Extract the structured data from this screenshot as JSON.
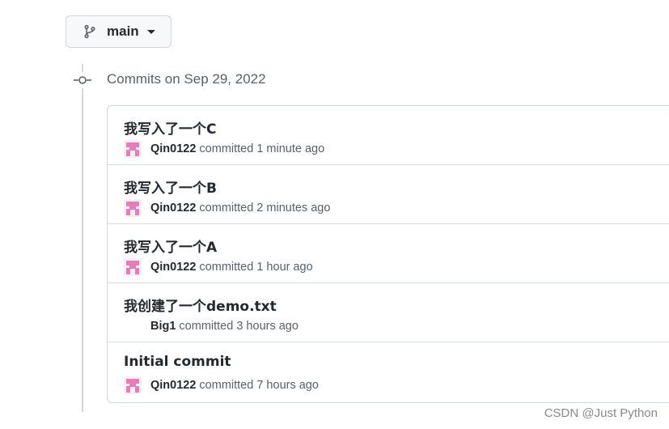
{
  "branch": {
    "name": "main",
    "icon": "git-branch-icon"
  },
  "timeline": {
    "heading": "Commits on Sep 29, 2022",
    "node_icon": "git-commit-icon"
  },
  "commits": [
    {
      "title": "我写入了一个C",
      "author": "Qin0122",
      "action": "committed",
      "time": "1 minute ago",
      "has_avatar": true
    },
    {
      "title": "我写入了一个B",
      "author": "Qin0122",
      "action": "committed",
      "time": "2 minutes ago",
      "has_avatar": true
    },
    {
      "title": "我写入了一个A",
      "author": "Qin0122",
      "action": "committed",
      "time": "1 hour ago",
      "has_avatar": true
    },
    {
      "title": "我创建了一个demo.txt",
      "author": "Big1",
      "action": "committed",
      "time": "3 hours ago",
      "has_avatar": false
    },
    {
      "title": "Initial commit",
      "author": "Qin0122",
      "action": "committed",
      "time": "7 hours ago",
      "has_avatar": true
    }
  ],
  "colors": {
    "accent_avatar": "#e87cb6",
    "border": "#d0d7de",
    "muted_text": "#57606a"
  },
  "watermark": "CSDN @Just Python"
}
